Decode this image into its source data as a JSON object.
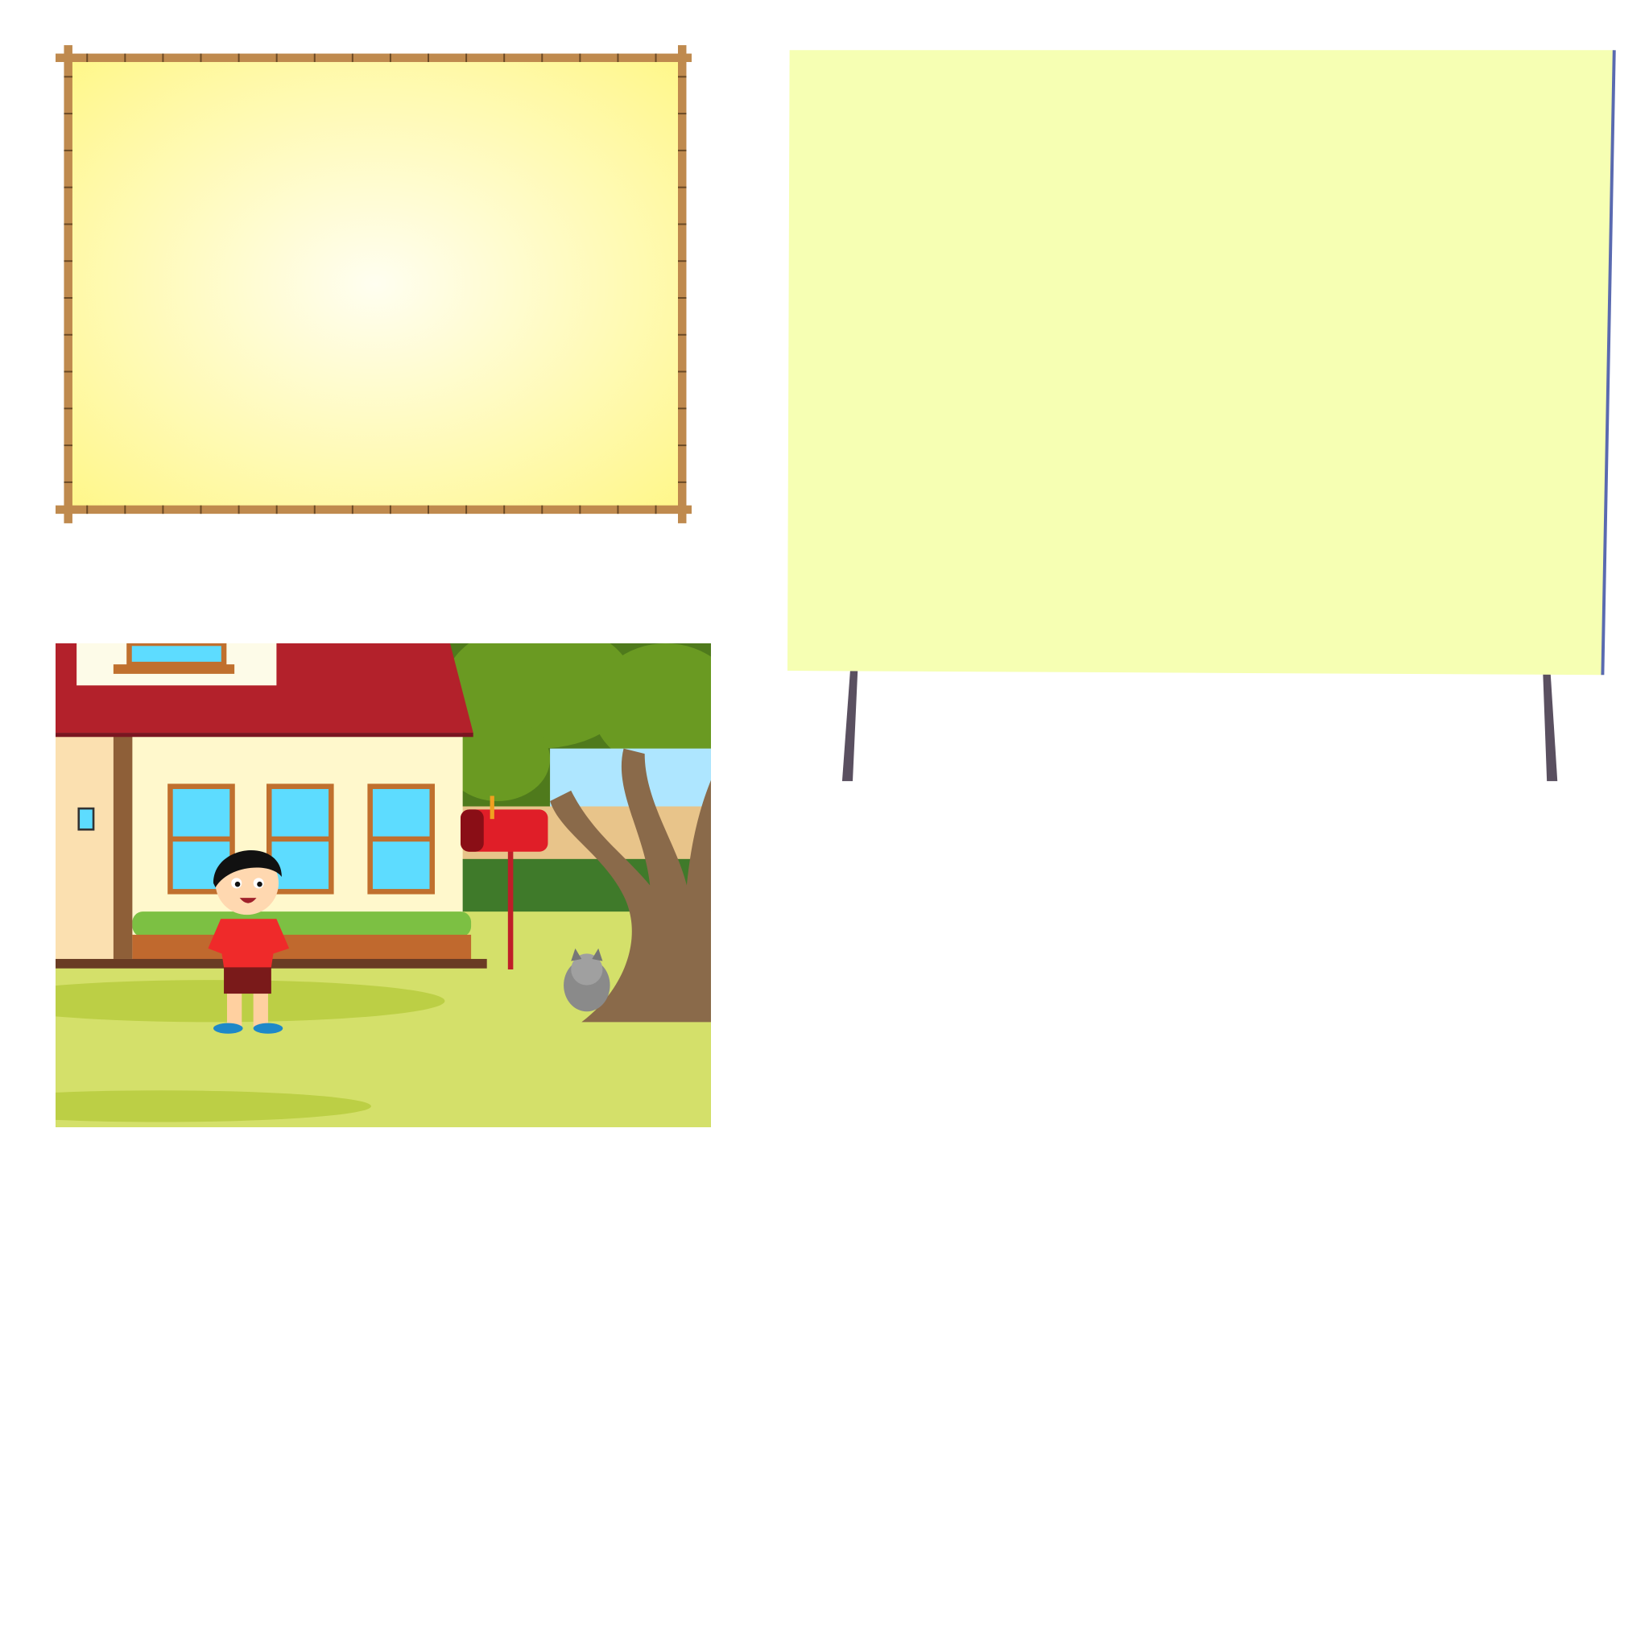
{
  "colors": {
    "bamboo": "#bf8a4e",
    "bamboo_panel_center": "#fffef0",
    "bamboo_panel_edge": "#fff78a",
    "board_surface": "#f6ffb3",
    "board_edge": "#5a6ab0",
    "board_legs": "#5a5060",
    "roof": "#b3212b",
    "wall": "#fff8cc",
    "window_glass": "#5ddcff",
    "grass": "#d4e06a",
    "mailbox": "#e01e28",
    "tree_trunk": "#8a6a4a",
    "boy_shirt": "#ef2a2a"
  }
}
